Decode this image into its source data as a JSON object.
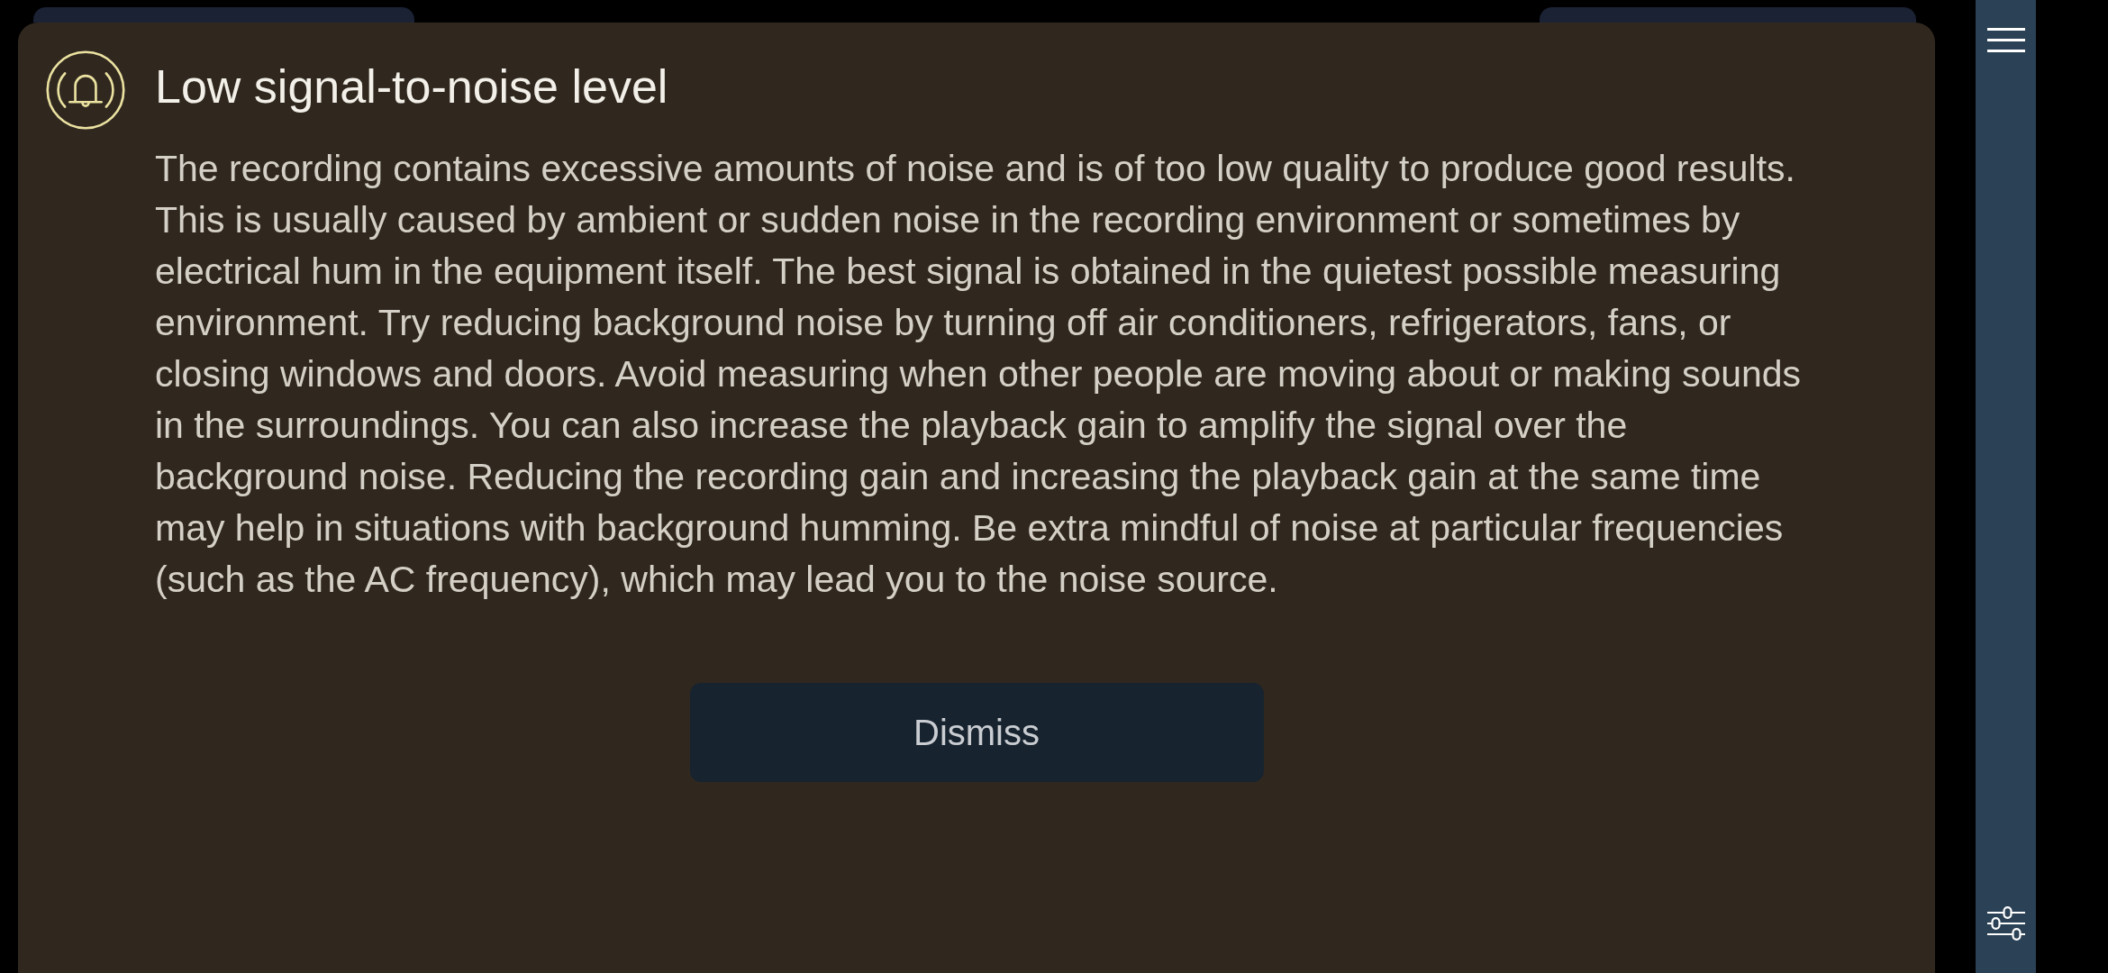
{
  "dialog": {
    "title": "Low signal-to-noise level",
    "message": "The recording contains excessive amounts of noise and is of too low quality to produce good results. This is usually caused by ambient or sudden noise in the recording environment or sometimes by electrical hum in the equipment itself. The best signal is obtained in the quietest possible measuring environment. Try reducing background noise by turning off air conditioners, refrigerators, fans, or closing windows and doors. Avoid measuring when other people are moving about or making sounds in the surroundings. You can also increase the playback gain to amplify the signal over the background noise. Reducing the recording gain and increasing the playback gain at the same time may help in situations with background humming. Be extra mindful of noise at particular frequencies (such as the AC frequency), which may lead you to the noise source.",
    "buttons": [
      "Dismiss"
    ]
  }
}
